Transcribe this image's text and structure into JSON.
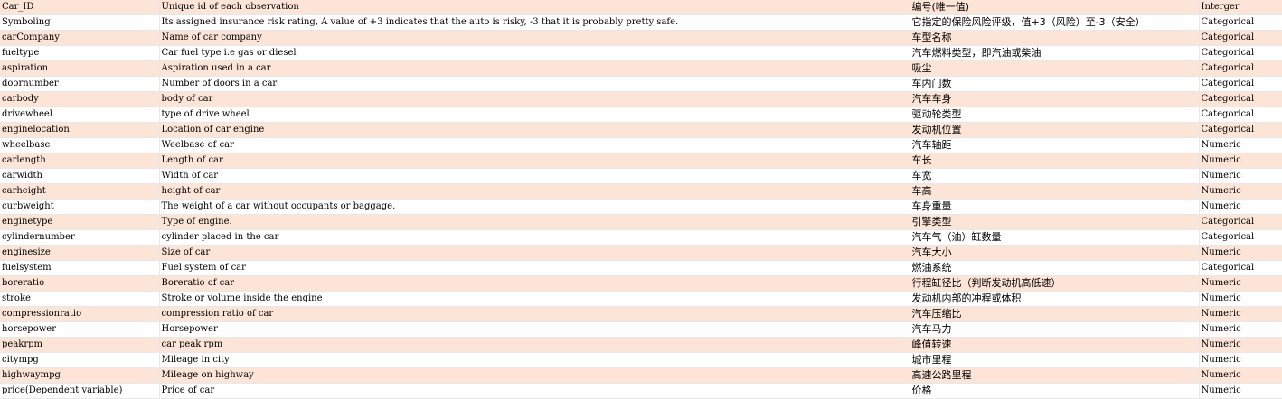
{
  "rows": [
    {
      "field": "Car_ID",
      "description": "Unique id of each observation",
      "description_zh": "编号(唯一值)",
      "type": "Interger"
    },
    {
      "field": "Symboling",
      "description": "Its assigned insurance risk rating, A value of +3 indicates that the  auto is risky, -3 that it is probably pretty safe.",
      "description_zh": "它指定的保险风险评级，值+3（风险）至-3（安全）",
      "type": "Categorical"
    },
    {
      "field": "carCompany",
      "description": "Name of car company",
      "description_zh": "车型名称",
      "type": "Categorical"
    },
    {
      "field": "fueltype",
      "description": "Car fuel type i.e gas or diesel",
      "description_zh": "汽车燃料类型，即汽油或柴油",
      "type": "Categorical"
    },
    {
      "field": "aspiration",
      "description": "Aspiration used in a car",
      "description_zh": "吸尘",
      "type": "Categorical"
    },
    {
      "field": "doornumber",
      "description": "Number of doors in a car",
      "description_zh": "车内门数",
      "type": "Categorical"
    },
    {
      "field": "carbody",
      "description": "body of car",
      "description_zh": "汽车车身",
      "type": "Categorical"
    },
    {
      "field": "drivewheel",
      "description": "type of drive wheel",
      "description_zh": "驱动轮类型",
      "type": "Categorical"
    },
    {
      "field": "enginelocation",
      "description": "Location of car engine",
      "description_zh": "发动机位置",
      "type": "Categorical"
    },
    {
      "field": "wheelbase",
      "description": "Weelbase of car",
      "description_zh": "汽车轴距",
      "type": "Numeric"
    },
    {
      "field": "carlength",
      "description": "Length of car",
      "description_zh": "车长",
      "type": "Numeric"
    },
    {
      "field": "carwidth",
      "description": "Width of car",
      "description_zh": "车宽",
      "type": "Numeric"
    },
    {
      "field": "carheight",
      "description": "height of car",
      "description_zh": "车高",
      "type": "Numeric"
    },
    {
      "field": "curbweight",
      "description": "The weight of a car without occupants or baggage.",
      "description_zh": "车身重量",
      "type": "Numeric"
    },
    {
      "field": "enginetype",
      "description": "Type of engine.",
      "description_zh": "引擎类型",
      "type": "Categorical"
    },
    {
      "field": "cylindernumber",
      "description": "cylinder placed in the car",
      "description_zh": "汽车气（油）缸数量",
      "type": "Categorical"
    },
    {
      "field": "enginesize",
      "description": "Size of car",
      "description_zh": "汽车大小",
      "type": "Numeric"
    },
    {
      "field": "fuelsystem",
      "description": "Fuel system of car",
      "description_zh": "燃油系统",
      "type": "Categorical"
    },
    {
      "field": "boreratio",
      "description": "Boreratio of car",
      "description_zh": "行程缸径比（判断发动机高低速）",
      "type": "Numeric"
    },
    {
      "field": "stroke",
      "description": "Stroke or volume inside the engine",
      "description_zh": "发动机内部的冲程或体积",
      "type": "Numeric"
    },
    {
      "field": "compressionratio",
      "description": "compression ratio of car",
      "description_zh": "汽车压缩比",
      "type": "Numeric"
    },
    {
      "field": "horsepower",
      "description": "Horsepower",
      "description_zh": "汽车马力",
      "type": "Numeric"
    },
    {
      "field": "peakrpm",
      "description": "car peak rpm",
      "description_zh": "峰值转速",
      "type": "Numeric"
    },
    {
      "field": "citympg",
      "description": "Mileage in city",
      "description_zh": "城市里程",
      "type": "Numeric"
    },
    {
      "field": "highwaympg",
      "description": "Mileage on highway",
      "description_zh": "高速公路里程",
      "type": "Numeric"
    },
    {
      "field": "price(Dependent variable)",
      "description": "Price of car",
      "description_zh": "价格",
      "type": "Numeric"
    }
  ]
}
